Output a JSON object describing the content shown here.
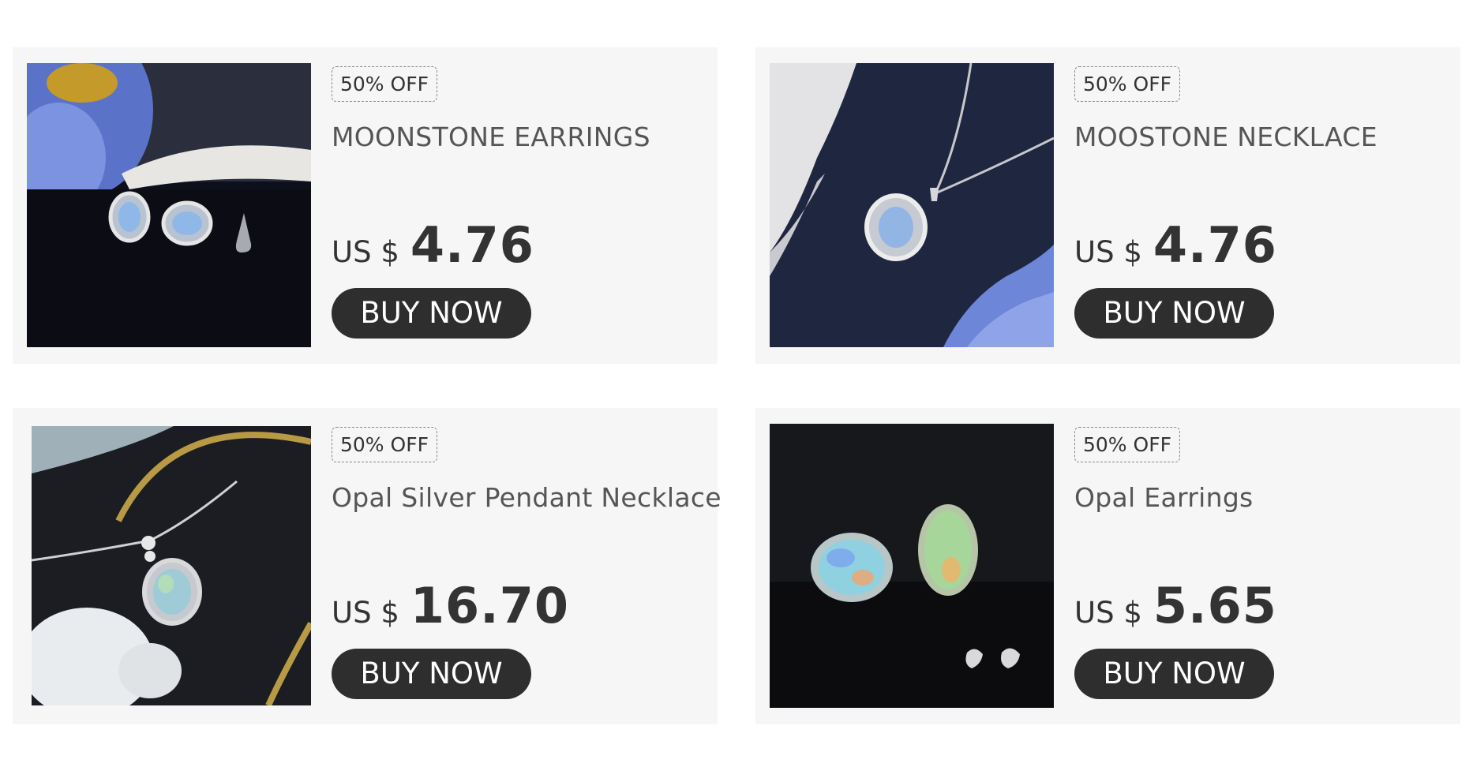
{
  "products": [
    {
      "badge": "50% OFF",
      "title": "MOONSTONE EARRINGS",
      "currency": "US $",
      "price": "4.76",
      "button": "BUY NOW"
    },
    {
      "badge": "50% OFF",
      "title": "MOOSTONE NECKLACE",
      "currency": "US $",
      "price": "4.76",
      "button": "BUY NOW"
    },
    {
      "badge": "50% OFF",
      "title": "Opal Silver Pendant Necklace",
      "currency": "US $",
      "price": "16.70",
      "button": "BUY NOW"
    },
    {
      "badge": "50% OFF",
      "title": "Opal Earrings",
      "currency": "US $",
      "price": "5.65",
      "button": "BUY NOW"
    }
  ],
  "colors": {
    "card_background": "#f6f6f6",
    "button_background": "#2e2e2e",
    "button_text": "#ffffff",
    "price_text": "#333333",
    "title_text": "#555555"
  }
}
